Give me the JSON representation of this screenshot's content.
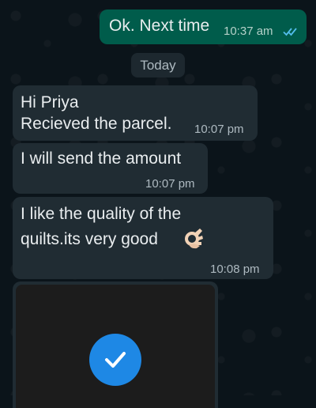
{
  "messages": {
    "outgoing_1": {
      "text": "Ok. Next time",
      "time": "10:37 am",
      "status_icon": "double-check-read-icon"
    },
    "day_separator": "Today",
    "incoming_1": {
      "line1": "Hi Priya",
      "line2": "Recieved the parcel.",
      "time": "10:07 pm"
    },
    "incoming_2": {
      "text": "I will send the amount",
      "time": "10:07 pm"
    },
    "incoming_3": {
      "line1": "I like the quality of the",
      "line2": "quilts.its very good",
      "emoji": "ok-hand-emoji",
      "time": "10:08 pm"
    },
    "media_4": {
      "icon": "check-circle-icon"
    }
  },
  "colors": {
    "background": "#0b141a",
    "outgoing_bubble": "#005c4b",
    "incoming_bubble": "#202c33",
    "read_ticks": "#53bdeb",
    "check_circle": "#1e88e5"
  }
}
